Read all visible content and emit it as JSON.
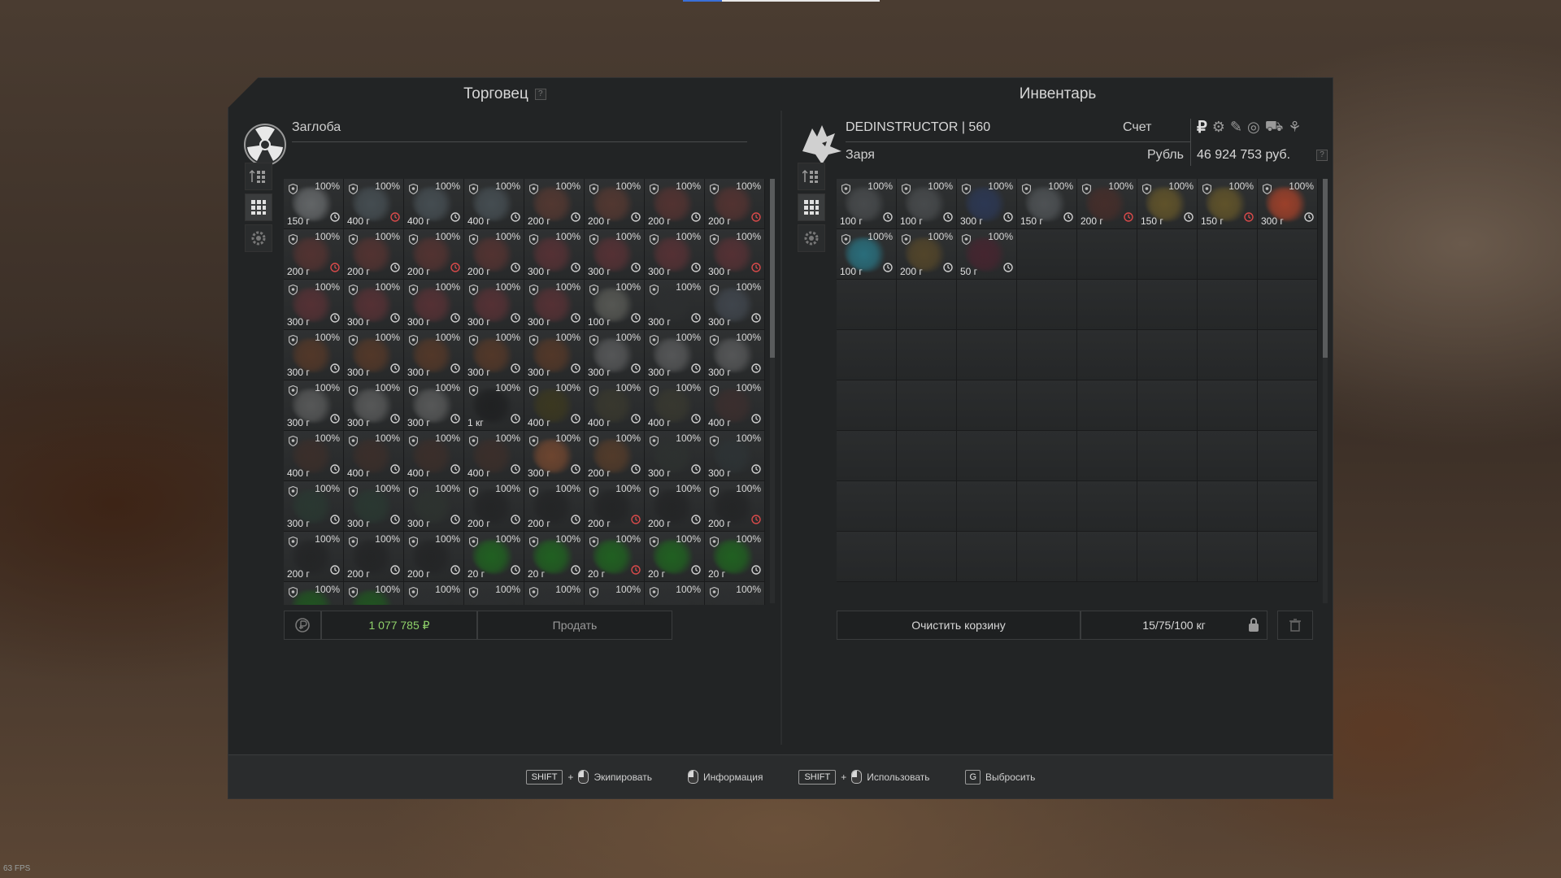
{
  "trader": {
    "title": "Торговец",
    "help": "?",
    "name": "Заглоба",
    "money_total": "1 077 785 ₽",
    "sell_label": "Продать"
  },
  "inventory": {
    "title": "Инвентарь",
    "player_name": "DEDINSTRUCTOR | 560",
    "faction": "Заря",
    "account_label": "Счет",
    "currency_label": "Рубль",
    "balance": "46 924 753 руб.",
    "help": "?",
    "clear_label": "Очистить корзину",
    "weight": "15/75/100 кг",
    "currency_icons": [
      "₽",
      "⚙",
      "✎",
      "◎",
      "⛟",
      "⚘"
    ]
  },
  "footer": {
    "equip": {
      "key": "SHIFT",
      "plus": "+",
      "label": "Экипировать"
    },
    "info": {
      "label": "Информация"
    },
    "use": {
      "key": "SHIFT",
      "plus": "+",
      "label": "Использовать"
    },
    "drop": {
      "key": "G",
      "label": "Выбросить"
    }
  },
  "fps": "63 FPS",
  "colors": {
    "accent_green": "#8fd16a",
    "warn_red": "#d84a4a",
    "panel": "#222425"
  },
  "trader_items": [
    {
      "d": "100%",
      "w": "150 г",
      "t": "n",
      "c": "#6d7072"
    },
    {
      "d": "100%",
      "w": "400 г",
      "t": "r",
      "c": "#4a5358"
    },
    {
      "d": "100%",
      "w": "400 г",
      "t": "n",
      "c": "#4a5358"
    },
    {
      "d": "100%",
      "w": "400 г",
      "t": "n",
      "c": "#4a5358"
    },
    {
      "d": "100%",
      "w": "200 г",
      "t": "n",
      "c": "#5a3a32"
    },
    {
      "d": "100%",
      "w": "200 г",
      "t": "n",
      "c": "#5a3a32"
    },
    {
      "d": "100%",
      "w": "200 г",
      "t": "n",
      "c": "#5a3432"
    },
    {
      "d": "100%",
      "w": "200 г",
      "t": "r",
      "c": "#5a3432"
    },
    {
      "d": "100%",
      "w": "200 г",
      "t": "r",
      "c": "#5a3432"
    },
    {
      "d": "100%",
      "w": "200 г",
      "t": "n",
      "c": "#5a3432"
    },
    {
      "d": "100%",
      "w": "200 г",
      "t": "r",
      "c": "#5a3432"
    },
    {
      "d": "100%",
      "w": "200 г",
      "t": "n",
      "c": "#5a3432"
    },
    {
      "d": "100%",
      "w": "300 г",
      "t": "n",
      "c": "#5d3236"
    },
    {
      "d": "100%",
      "w": "300 г",
      "t": "n",
      "c": "#5d3236"
    },
    {
      "d": "100%",
      "w": "300 г",
      "t": "n",
      "c": "#5d3236"
    },
    {
      "d": "100%",
      "w": "300 г",
      "t": "r",
      "c": "#5d3236"
    },
    {
      "d": "100%",
      "w": "300 г",
      "t": "n",
      "c": "#5d3236"
    },
    {
      "d": "100%",
      "w": "300 г",
      "t": "n",
      "c": "#5d3236"
    },
    {
      "d": "100%",
      "w": "300 г",
      "t": "n",
      "c": "#5d3236"
    },
    {
      "d": "100%",
      "w": "300 г",
      "t": "n",
      "c": "#5d3236"
    },
    {
      "d": "100%",
      "w": "300 г",
      "t": "n",
      "c": "#5d3236"
    },
    {
      "d": "100%",
      "w": "100 г",
      "t": "n",
      "c": "#5e5f5a"
    },
    {
      "d": "100%",
      "w": "300 г",
      "t": "n",
      "c": "#2d2f30"
    },
    {
      "d": "100%",
      "w": "300 г",
      "t": "n",
      "c": "#444a52"
    },
    {
      "d": "100%",
      "w": "300 г",
      "t": "n",
      "c": "#5a3a28"
    },
    {
      "d": "100%",
      "w": "300 г",
      "t": "n",
      "c": "#5a3a28"
    },
    {
      "d": "100%",
      "w": "300 г",
      "t": "n",
      "c": "#5a3a28"
    },
    {
      "d": "100%",
      "w": "300 г",
      "t": "n",
      "c": "#5a3a28"
    },
    {
      "d": "100%",
      "w": "300 г",
      "t": "n",
      "c": "#5a3a28"
    },
    {
      "d": "100%",
      "w": "300 г",
      "t": "n",
      "c": "#5d5e5f"
    },
    {
      "d": "100%",
      "w": "300 г",
      "t": "n",
      "c": "#5d5e5f"
    },
    {
      "d": "100%",
      "w": "300 г",
      "t": "n",
      "c": "#5d5e5f"
    },
    {
      "d": "100%",
      "w": "300 г",
      "t": "n",
      "c": "#5f6060"
    },
    {
      "d": "100%",
      "w": "300 г",
      "t": "n",
      "c": "#5f6060"
    },
    {
      "d": "100%",
      "w": "300 г",
      "t": "n",
      "c": "#5f6060"
    },
    {
      "d": "100%",
      "w": "1 кг",
      "t": "n",
      "c": "#1e1f20"
    },
    {
      "d": "100%",
      "w": "400 г",
      "t": "n",
      "c": "#3e3a1e"
    },
    {
      "d": "100%",
      "w": "400 г",
      "t": "n",
      "c": "#3b3a2e"
    },
    {
      "d": "100%",
      "w": "400 г",
      "t": "n",
      "c": "#3a3a30"
    },
    {
      "d": "100%",
      "w": "400 г",
      "t": "n",
      "c": "#3e2f2e"
    },
    {
      "d": "100%",
      "w": "400 г",
      "t": "n",
      "c": "#3e2f2a"
    },
    {
      "d": "100%",
      "w": "400 г",
      "t": "n",
      "c": "#3e2f2a"
    },
    {
      "d": "100%",
      "w": "400 г",
      "t": "n",
      "c": "#3e2f2a"
    },
    {
      "d": "100%",
      "w": "400 г",
      "t": "n",
      "c": "#3e2f2a"
    },
    {
      "d": "100%",
      "w": "300 г",
      "t": "n",
      "c": "#7a4a30"
    },
    {
      "d": "100%",
      "w": "200 г",
      "t": "n",
      "c": "#5a3e2a"
    },
    {
      "d": "100%",
      "w": "300 г",
      "t": "n",
      "c": "#2e3230"
    },
    {
      "d": "100%",
      "w": "300 г",
      "t": "n",
      "c": "#2e3436"
    },
    {
      "d": "100%",
      "w": "300 г",
      "t": "n",
      "c": "#2a3a32"
    },
    {
      "d": "100%",
      "w": "300 г",
      "t": "n",
      "c": "#2a3a32"
    },
    {
      "d": "100%",
      "w": "300 г",
      "t": "n",
      "c": "#2e3430"
    },
    {
      "d": "100%",
      "w": "200 г",
      "t": "n",
      "c": "#232425"
    },
    {
      "d": "100%",
      "w": "200 г",
      "t": "n",
      "c": "#232425"
    },
    {
      "d": "100%",
      "w": "200 г",
      "t": "r",
      "c": "#232425"
    },
    {
      "d": "100%",
      "w": "200 г",
      "t": "n",
      "c": "#232425"
    },
    {
      "d": "100%",
      "w": "200 г",
      "t": "r",
      "c": "#232425"
    },
    {
      "d": "100%",
      "w": "200 г",
      "t": "n",
      "c": "#232425"
    },
    {
      "d": "100%",
      "w": "200 г",
      "t": "n",
      "c": "#232425"
    },
    {
      "d": "100%",
      "w": "200 г",
      "t": "n",
      "c": "#232425"
    },
    {
      "d": "100%",
      "w": "20 г",
      "t": "n",
      "c": "#1f6a1f"
    },
    {
      "d": "100%",
      "w": "20 г",
      "t": "n",
      "c": "#1f6a1f"
    },
    {
      "d": "100%",
      "w": "20 г",
      "t": "r",
      "c": "#1f6a1f"
    },
    {
      "d": "100%",
      "w": "20 г",
      "t": "n",
      "c": "#1f6a1f"
    },
    {
      "d": "100%",
      "w": "20 г",
      "t": "n",
      "c": "#1f6a1f"
    },
    {
      "d": "100%",
      "w": "",
      "t": "",
      "c": "#1f5a1f"
    },
    {
      "d": "100%",
      "w": "",
      "t": "",
      "c": "#1f5a1f"
    },
    {
      "d": "100%",
      "w": "",
      "t": "",
      "c": "#2d2f30"
    },
    {
      "d": "100%",
      "w": "",
      "t": "",
      "c": "#2d2f30"
    },
    {
      "d": "100%",
      "w": "",
      "t": "",
      "c": "#2d2f30"
    },
    {
      "d": "100%",
      "w": "",
      "t": "",
      "c": "#2d2f30"
    },
    {
      "d": "100%",
      "w": "",
      "t": "",
      "c": "#2d2f30"
    },
    {
      "d": "100%",
      "w": "",
      "t": "",
      "c": "#2d2f30"
    }
  ],
  "inventory_items": [
    {
      "d": "100%",
      "w": "100 г",
      "t": "n",
      "c": "#4d5052"
    },
    {
      "d": "100%",
      "w": "100 г",
      "t": "n",
      "c": "#4d5052"
    },
    {
      "d": "100%",
      "w": "300 г",
      "t": "n",
      "c": "#2d3a5a"
    },
    {
      "d": "100%",
      "w": "150 г",
      "t": "n",
      "c": "#55595c"
    },
    {
      "d": "100%",
      "w": "200 г",
      "t": "r",
      "c": "#4a2e2a"
    },
    {
      "d": "100%",
      "w": "150 г",
      "t": "n",
      "c": "#6a5a2a"
    },
    {
      "d": "100%",
      "w": "150 г",
      "t": "r",
      "c": "#6a5a2a"
    },
    {
      "d": "100%",
      "w": "300 г",
      "t": "n",
      "c": "#b0442a"
    },
    {
      "d": "100%",
      "w": "100 г",
      "t": "n",
      "c": "#2a7a8a"
    },
    {
      "d": "100%",
      "w": "200 г",
      "t": "n",
      "c": "#5a4a2a"
    },
    {
      "d": "100%",
      "w": "50 г",
      "t": "n",
      "c": "#4a2430"
    }
  ]
}
